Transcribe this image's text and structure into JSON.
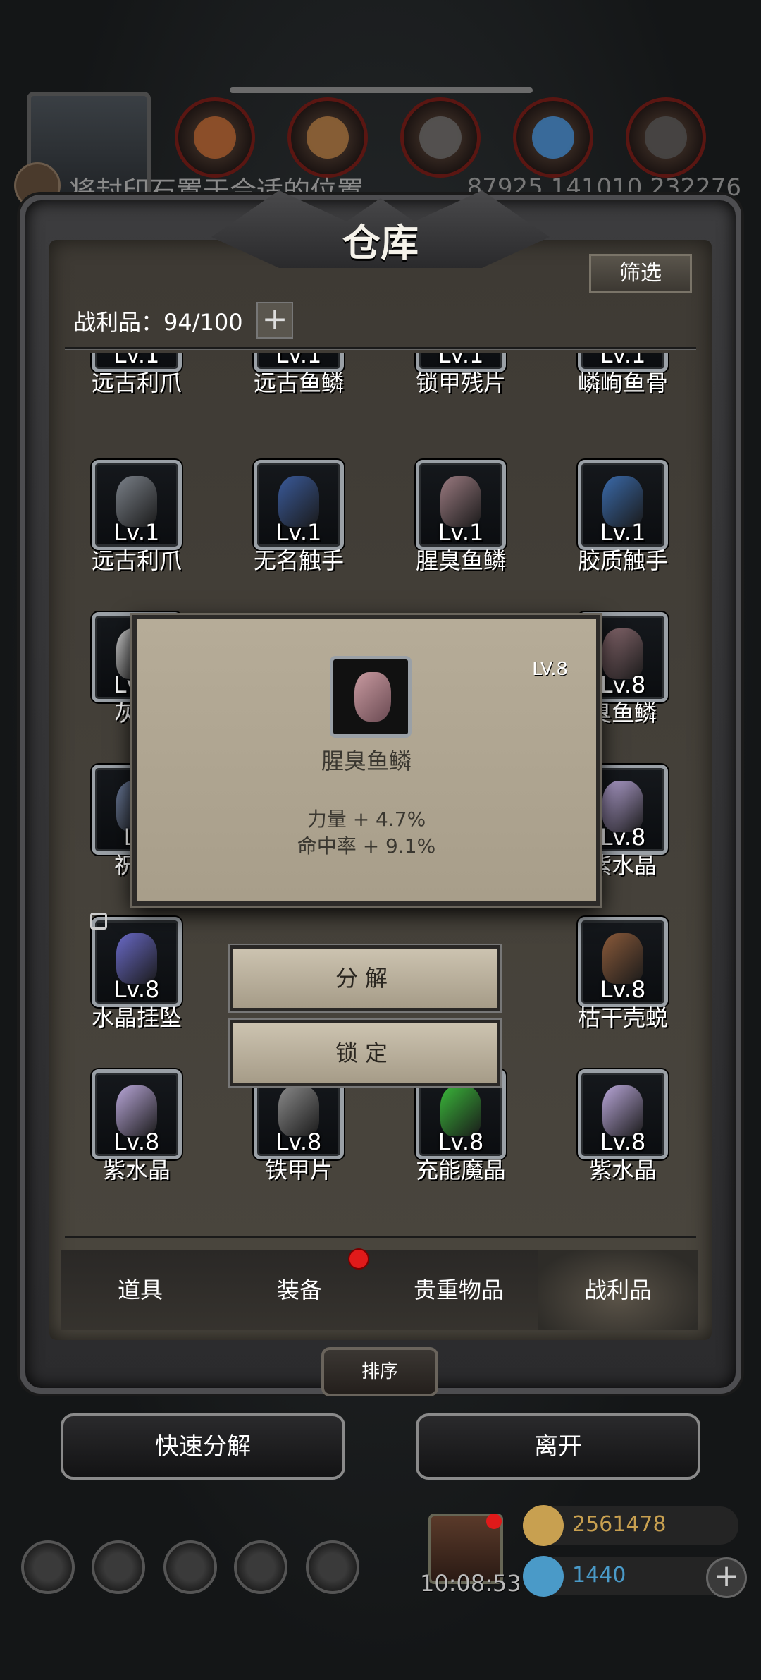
{
  "header": {
    "hint_text": "将封印石置于合适的位置",
    "hint_numbers": "87925  141010  232276"
  },
  "panel": {
    "title": "仓库",
    "filter_label": "筛选",
    "capacity_label": "战利品：94/100",
    "capacity_plus": "+"
  },
  "items": [
    {
      "lv": "Lv.1",
      "name": "远古利爪",
      "color": "#7a8088"
    },
    {
      "lv": "Lv.1",
      "name": "远古鱼鳞",
      "color": "#a07a86"
    },
    {
      "lv": "Lv.1",
      "name": "锁甲残片",
      "color": "#8a7a5a"
    },
    {
      "lv": "Lv.1",
      "name": "嶙峋鱼骨",
      "color": "#cfcfcf"
    },
    {
      "lv": "Lv.1",
      "name": "远古利爪",
      "color": "#7a8088"
    },
    {
      "lv": "Lv.1",
      "name": "无名触手",
      "color": "#3a5a9a"
    },
    {
      "lv": "Lv.1",
      "name": "腥臭鱼鳞",
      "color": "#9a7a80"
    },
    {
      "lv": "Lv.1",
      "name": "胶质触手",
      "color": "#3a6aaa"
    },
    {
      "lv": "Lv.8",
      "name": "灰色",
      "color": "#cfcfcf"
    },
    {
      "lv": "",
      "name": "",
      "color": "#000"
    },
    {
      "lv": "",
      "name": "",
      "color": "#000"
    },
    {
      "lv": "Lv.8",
      "name": "臭鱼鳞",
      "color": "#8a6a70"
    },
    {
      "lv": "Lv",
      "name": "祝福",
      "color": "#6a7a9a"
    },
    {
      "lv": "",
      "name": "",
      "color": "#000"
    },
    {
      "lv": "",
      "name": "",
      "color": "#000"
    },
    {
      "lv": "Lv.8",
      "name": "紫水晶",
      "color": "#b8a6d8"
    },
    {
      "lv": "Lv.8",
      "name": "水晶挂坠",
      "color": "#6a6ac8"
    },
    {
      "lv": "",
      "name": "",
      "color": "#000"
    },
    {
      "lv": "",
      "name": "",
      "color": "#000"
    },
    {
      "lv": "Lv.8",
      "name": "枯干壳蜕",
      "color": "#8a5a3a"
    },
    {
      "lv": "Lv.8",
      "name": "紫水晶",
      "color": "#b8a6d8"
    },
    {
      "lv": "Lv.8",
      "name": "铁甲片",
      "color": "#8a8a8a"
    },
    {
      "lv": "Lv.8",
      "name": "充能魔晶",
      "color": "#3ab83a"
    },
    {
      "lv": "Lv.8",
      "name": "紫水晶",
      "color": "#b8a6d8"
    }
  ],
  "popup": {
    "level": "LV.8",
    "name": "腥臭鱼鳞",
    "stat1": "力量 + 4.7%",
    "stat2": "命中率 + 9.1%"
  },
  "context_menu": {
    "decompose": "分解",
    "lock": "锁定"
  },
  "tabs": [
    "道具",
    "装备",
    "贵重物品",
    "战利品"
  ],
  "sort_label": "排序",
  "actions": {
    "quick_decompose": "快速分解",
    "leave": "离开"
  },
  "hud": {
    "clock": "10:08:53",
    "gold": "2561478",
    "gems": "1440",
    "gold_color": "#c8a050",
    "gem_color": "#4a9ac8"
  }
}
